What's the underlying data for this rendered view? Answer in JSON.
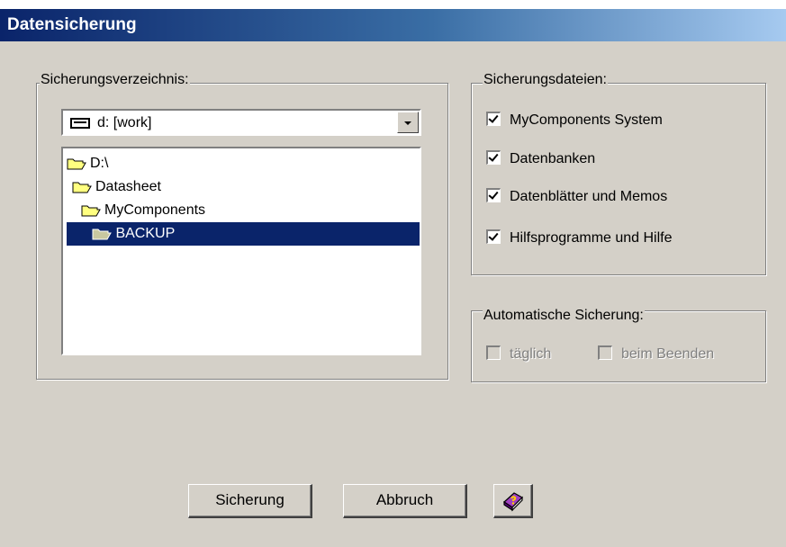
{
  "window": {
    "title": "Datensicherung"
  },
  "directory_group": {
    "label": "Sicherungsverzeichnis:",
    "drive": {
      "value": "d: [work]",
      "icon": "drive-icon"
    },
    "tree": [
      {
        "label": "D:\\",
        "level": 0,
        "selected": false
      },
      {
        "label": "Datasheet",
        "level": 1,
        "selected": false
      },
      {
        "label": "MyComponents",
        "level": 2,
        "selected": false
      },
      {
        "label": "BACKUP",
        "level": 3,
        "selected": true
      }
    ]
  },
  "files_group": {
    "label": "Sicherungsdateien:",
    "items": [
      {
        "label": "MyComponents System",
        "checked": true
      },
      {
        "label": "Datenbanken",
        "checked": true
      },
      {
        "label": "Datenblätter und Memos",
        "checked": true
      },
      {
        "label": "Hilfsprogramme und Hilfe",
        "checked": true
      }
    ]
  },
  "auto_group": {
    "label": "Automatische Sicherung:",
    "items": [
      {
        "label": "täglich",
        "checked": false,
        "enabled": false
      },
      {
        "label": "beim Beenden",
        "checked": false,
        "enabled": false
      }
    ]
  },
  "buttons": {
    "backup": "Sicherung",
    "cancel": "Abbruch",
    "help_icon": "help-book-icon"
  }
}
